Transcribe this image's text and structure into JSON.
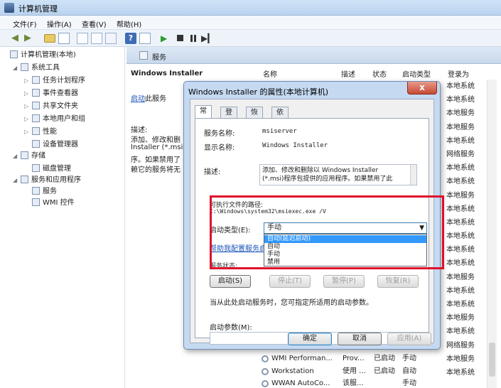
{
  "window": {
    "title": "计算机管理"
  },
  "menu": [
    "文件(F)",
    "操作(A)",
    "查看(V)",
    "帮助(H)"
  ],
  "tree": [
    {
      "label": "计算机管理(本地)",
      "level": 0,
      "expander": ""
    },
    {
      "label": "系统工具",
      "level": 1,
      "expander": "◢"
    },
    {
      "label": "任务计划程序",
      "level": 2,
      "expander": "▷"
    },
    {
      "label": "事件查看器",
      "level": 2,
      "expander": "▷"
    },
    {
      "label": "共享文件夹",
      "level": 2,
      "expander": "▷"
    },
    {
      "label": "本地用户和组",
      "level": 2,
      "expander": "▷"
    },
    {
      "label": "性能",
      "level": 2,
      "expander": "▷"
    },
    {
      "label": "设备管理器",
      "level": 2,
      "expander": ""
    },
    {
      "label": "存储",
      "level": 1,
      "expander": "◢"
    },
    {
      "label": "磁盘管理",
      "level": 2,
      "expander": ""
    },
    {
      "label": "服务和应用程序",
      "level": 1,
      "expander": "◢"
    },
    {
      "label": "服务",
      "level": 2,
      "expander": ""
    },
    {
      "label": "WMI 控件",
      "level": 2,
      "expander": ""
    }
  ],
  "services_header": {
    "label": "服务"
  },
  "detail": {
    "title": "Windows Installer",
    "start_link": "启动",
    "start_suffix": "此服务",
    "desc_label": "描述:",
    "desc_lines": [
      "添加、修改和删",
      "Installer (*.msi",
      "序。如果禁用了",
      "赖它的服务将无"
    ]
  },
  "columns": [
    "名称",
    "描述",
    "状态",
    "启动类型",
    "登录为"
  ],
  "logon_values": [
    "本地系统",
    "本地系统",
    "本地服务",
    "本地服务",
    "本地系统",
    "网络服务",
    "本地系统",
    "本地系统",
    "本地服务",
    "本地系统",
    "本地系统",
    "本地系统",
    "本地系统",
    "本地系统",
    "本地服务",
    "本地系统",
    "本地系统",
    "本地服务",
    "本地系统",
    "网络服务",
    "本地服务",
    "本地系统"
  ],
  "service_rows": [
    {
      "name": "WMI Performan...",
      "desc": "Prov...",
      "status": "已启动",
      "type": "手动"
    },
    {
      "name": "Workstation",
      "desc": "使用 ...",
      "status": "已启动",
      "type": "自动"
    },
    {
      "name": "WWAN AutoCo...",
      "desc": "该服...",
      "status": "",
      "type": "手动"
    }
  ],
  "dialog": {
    "title": "Windows Installer 的属性(本地计算机)",
    "close": "x",
    "tabs": [
      "常规",
      "登录",
      "恢复",
      "依存关系"
    ],
    "service_name_label": "服务名称:",
    "service_name": "msiserver",
    "display_name_label": "显示名称:",
    "display_name": "Windows Installer",
    "desc_label": "描述:",
    "desc_lines": [
      "添加、修改和删除以 Windows Installer",
      "(*.msi)程序包提供的应用程序。如果禁用了此"
    ],
    "exec_label": "可执行文件的路径:",
    "exec_path": "C:\\Windows\\system32\\msiexec.exe /V",
    "startup_type_label": "启动类型(E):",
    "startup_type_value": "手动",
    "startup_options": [
      "自动(延迟启动)",
      "自动",
      "手动",
      "禁用"
    ],
    "help_link": "帮助我配置服务启",
    "status_label": "服务状态:",
    "buttons": {
      "start": "启动(S)",
      "stop": "停止(T)",
      "pause": "暂停(P)",
      "resume": "恢复(R)"
    },
    "hint": "当从此处启动服务时，您可指定所适用的启动参数。",
    "param_label": "启动参数(M):",
    "ok": "确定",
    "cancel": "取消",
    "apply": "应用(A)"
  }
}
